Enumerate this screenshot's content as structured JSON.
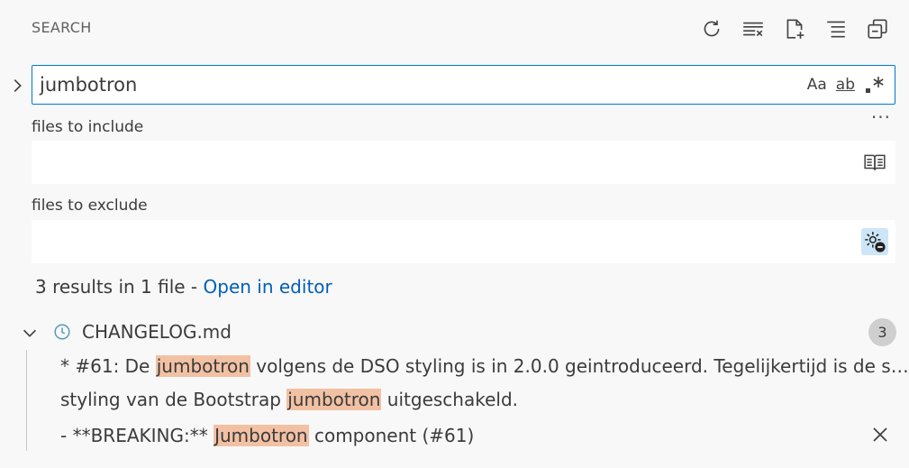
{
  "header": {
    "title": "SEARCH"
  },
  "toolbar": {
    "actions": [
      {
        "name": "refresh",
        "icon": "refresh-icon"
      },
      {
        "name": "clear-search-results",
        "icon": "clear-all-icon"
      },
      {
        "name": "new-search-editor",
        "icon": "new-file-icon"
      },
      {
        "name": "view-as-tree",
        "icon": "list-tree-icon"
      },
      {
        "name": "collapse-all",
        "icon": "collapse-all-icon"
      }
    ]
  },
  "search": {
    "value": "jumbotron",
    "options": {
      "match_case": "Aa",
      "whole_word": "ab",
      "regex": ".*"
    }
  },
  "include": {
    "label": "files to include",
    "value": "",
    "more": "···"
  },
  "exclude": {
    "label": "files to exclude",
    "value": ""
  },
  "summary": {
    "text": "3 results in 1 file - ",
    "link": "Open in editor"
  },
  "results": {
    "file": {
      "name": "CHANGELOG.md",
      "count": "3"
    },
    "matches": [
      {
        "before": "* #61: De ",
        "match": "jumbotron",
        "after": " volgens de DSO styling is in 2.0.0 geintroduceerd. Tegelijkertijd is de styling van de Bootstrap jumbotron uitgeschakeld."
      },
      {
        "before": "styling van de Bootstrap ",
        "match": "jumbotron",
        "after": " uitgeschakeld."
      },
      {
        "before": "- **BREAKING:** ",
        "match": "Jumbotron",
        "after": " component (#61)"
      }
    ]
  },
  "colors": {
    "accent": "#0078d4",
    "link": "#005fb8",
    "highlight": "#f2c1a4"
  }
}
